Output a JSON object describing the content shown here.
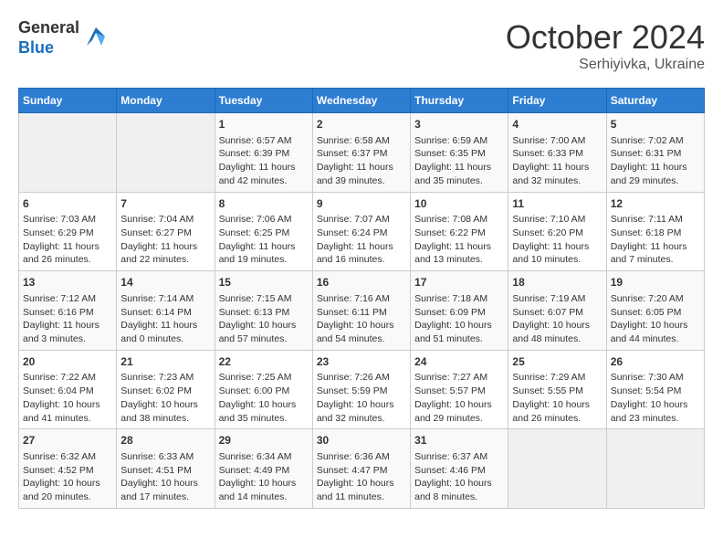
{
  "header": {
    "logo_general": "General",
    "logo_blue": "Blue",
    "month_title": "October 2024",
    "subtitle": "Serhiyivka, Ukraine"
  },
  "days_of_week": [
    "Sunday",
    "Monday",
    "Tuesday",
    "Wednesday",
    "Thursday",
    "Friday",
    "Saturday"
  ],
  "weeks": [
    [
      {
        "num": "",
        "data": ""
      },
      {
        "num": "",
        "data": ""
      },
      {
        "num": "1",
        "data": "Sunrise: 6:57 AM\nSunset: 6:39 PM\nDaylight: 11 hours and 42 minutes."
      },
      {
        "num": "2",
        "data": "Sunrise: 6:58 AM\nSunset: 6:37 PM\nDaylight: 11 hours and 39 minutes."
      },
      {
        "num": "3",
        "data": "Sunrise: 6:59 AM\nSunset: 6:35 PM\nDaylight: 11 hours and 35 minutes."
      },
      {
        "num": "4",
        "data": "Sunrise: 7:00 AM\nSunset: 6:33 PM\nDaylight: 11 hours and 32 minutes."
      },
      {
        "num": "5",
        "data": "Sunrise: 7:02 AM\nSunset: 6:31 PM\nDaylight: 11 hours and 29 minutes."
      }
    ],
    [
      {
        "num": "6",
        "data": "Sunrise: 7:03 AM\nSunset: 6:29 PM\nDaylight: 11 hours and 26 minutes."
      },
      {
        "num": "7",
        "data": "Sunrise: 7:04 AM\nSunset: 6:27 PM\nDaylight: 11 hours and 22 minutes."
      },
      {
        "num": "8",
        "data": "Sunrise: 7:06 AM\nSunset: 6:25 PM\nDaylight: 11 hours and 19 minutes."
      },
      {
        "num": "9",
        "data": "Sunrise: 7:07 AM\nSunset: 6:24 PM\nDaylight: 11 hours and 16 minutes."
      },
      {
        "num": "10",
        "data": "Sunrise: 7:08 AM\nSunset: 6:22 PM\nDaylight: 11 hours and 13 minutes."
      },
      {
        "num": "11",
        "data": "Sunrise: 7:10 AM\nSunset: 6:20 PM\nDaylight: 11 hours and 10 minutes."
      },
      {
        "num": "12",
        "data": "Sunrise: 7:11 AM\nSunset: 6:18 PM\nDaylight: 11 hours and 7 minutes."
      }
    ],
    [
      {
        "num": "13",
        "data": "Sunrise: 7:12 AM\nSunset: 6:16 PM\nDaylight: 11 hours and 3 minutes."
      },
      {
        "num": "14",
        "data": "Sunrise: 7:14 AM\nSunset: 6:14 PM\nDaylight: 11 hours and 0 minutes."
      },
      {
        "num": "15",
        "data": "Sunrise: 7:15 AM\nSunset: 6:13 PM\nDaylight: 10 hours and 57 minutes."
      },
      {
        "num": "16",
        "data": "Sunrise: 7:16 AM\nSunset: 6:11 PM\nDaylight: 10 hours and 54 minutes."
      },
      {
        "num": "17",
        "data": "Sunrise: 7:18 AM\nSunset: 6:09 PM\nDaylight: 10 hours and 51 minutes."
      },
      {
        "num": "18",
        "data": "Sunrise: 7:19 AM\nSunset: 6:07 PM\nDaylight: 10 hours and 48 minutes."
      },
      {
        "num": "19",
        "data": "Sunrise: 7:20 AM\nSunset: 6:05 PM\nDaylight: 10 hours and 44 minutes."
      }
    ],
    [
      {
        "num": "20",
        "data": "Sunrise: 7:22 AM\nSunset: 6:04 PM\nDaylight: 10 hours and 41 minutes."
      },
      {
        "num": "21",
        "data": "Sunrise: 7:23 AM\nSunset: 6:02 PM\nDaylight: 10 hours and 38 minutes."
      },
      {
        "num": "22",
        "data": "Sunrise: 7:25 AM\nSunset: 6:00 PM\nDaylight: 10 hours and 35 minutes."
      },
      {
        "num": "23",
        "data": "Sunrise: 7:26 AM\nSunset: 5:59 PM\nDaylight: 10 hours and 32 minutes."
      },
      {
        "num": "24",
        "data": "Sunrise: 7:27 AM\nSunset: 5:57 PM\nDaylight: 10 hours and 29 minutes."
      },
      {
        "num": "25",
        "data": "Sunrise: 7:29 AM\nSunset: 5:55 PM\nDaylight: 10 hours and 26 minutes."
      },
      {
        "num": "26",
        "data": "Sunrise: 7:30 AM\nSunset: 5:54 PM\nDaylight: 10 hours and 23 minutes."
      }
    ],
    [
      {
        "num": "27",
        "data": "Sunrise: 6:32 AM\nSunset: 4:52 PM\nDaylight: 10 hours and 20 minutes."
      },
      {
        "num": "28",
        "data": "Sunrise: 6:33 AM\nSunset: 4:51 PM\nDaylight: 10 hours and 17 minutes."
      },
      {
        "num": "29",
        "data": "Sunrise: 6:34 AM\nSunset: 4:49 PM\nDaylight: 10 hours and 14 minutes."
      },
      {
        "num": "30",
        "data": "Sunrise: 6:36 AM\nSunset: 4:47 PM\nDaylight: 10 hours and 11 minutes."
      },
      {
        "num": "31",
        "data": "Sunrise: 6:37 AM\nSunset: 4:46 PM\nDaylight: 10 hours and 8 minutes."
      },
      {
        "num": "",
        "data": ""
      },
      {
        "num": "",
        "data": ""
      }
    ]
  ]
}
